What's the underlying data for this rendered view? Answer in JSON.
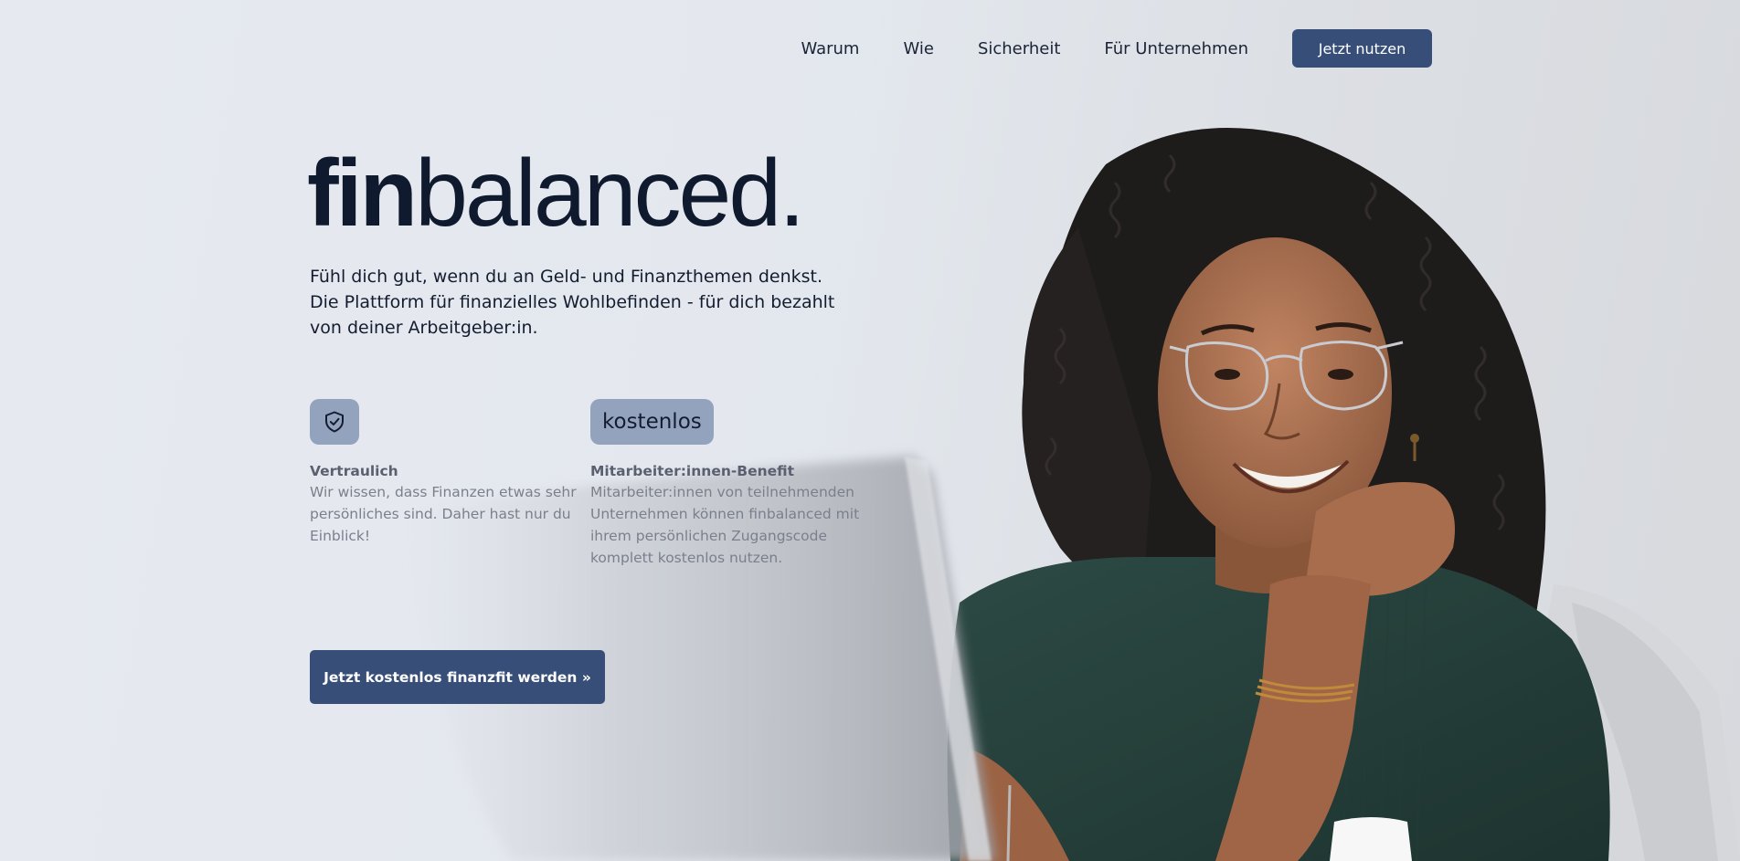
{
  "nav": {
    "links": [
      "Warum",
      "Wie",
      "Sicherheit",
      "Für Unternehmen"
    ],
    "cta_label": "Jetzt nutzen"
  },
  "hero": {
    "logo_bold": "fin",
    "logo_light": "balanced.",
    "tagline_lines": [
      "Fühl dich gut, wenn du an Geld- und Finanzthemen denkst.",
      "Die Plattform für finanzielles Wohlbefinden - für dich bezahlt",
      "von deiner Arbeitgeber:in."
    ],
    "cta_label": "Jetzt kostenlos finanzfit werden »"
  },
  "features": [
    {
      "icon": "shield-check-icon",
      "title": "Vertraulich",
      "text_lines": [
        "Wir wissen, dass Finanzen etwas sehr",
        "persönliches sind. Daher hast nur du",
        "Einblick!"
      ]
    },
    {
      "badge_text": "kostenlos",
      "title": "Mitarbeiter:innen-Benefit",
      "text_lines": [
        "Mitarbeiter:innen von teilnehmenden",
        "Unternehmen können finbalanced mit",
        "ihrem persönlichen Zugangscode",
        "komplett kostenlos nutzen."
      ]
    }
  ],
  "colors": {
    "primary": "#374e79",
    "badge": "#94a3bd",
    "text_dark": "#141d30",
    "background": "#e6eaf0"
  }
}
